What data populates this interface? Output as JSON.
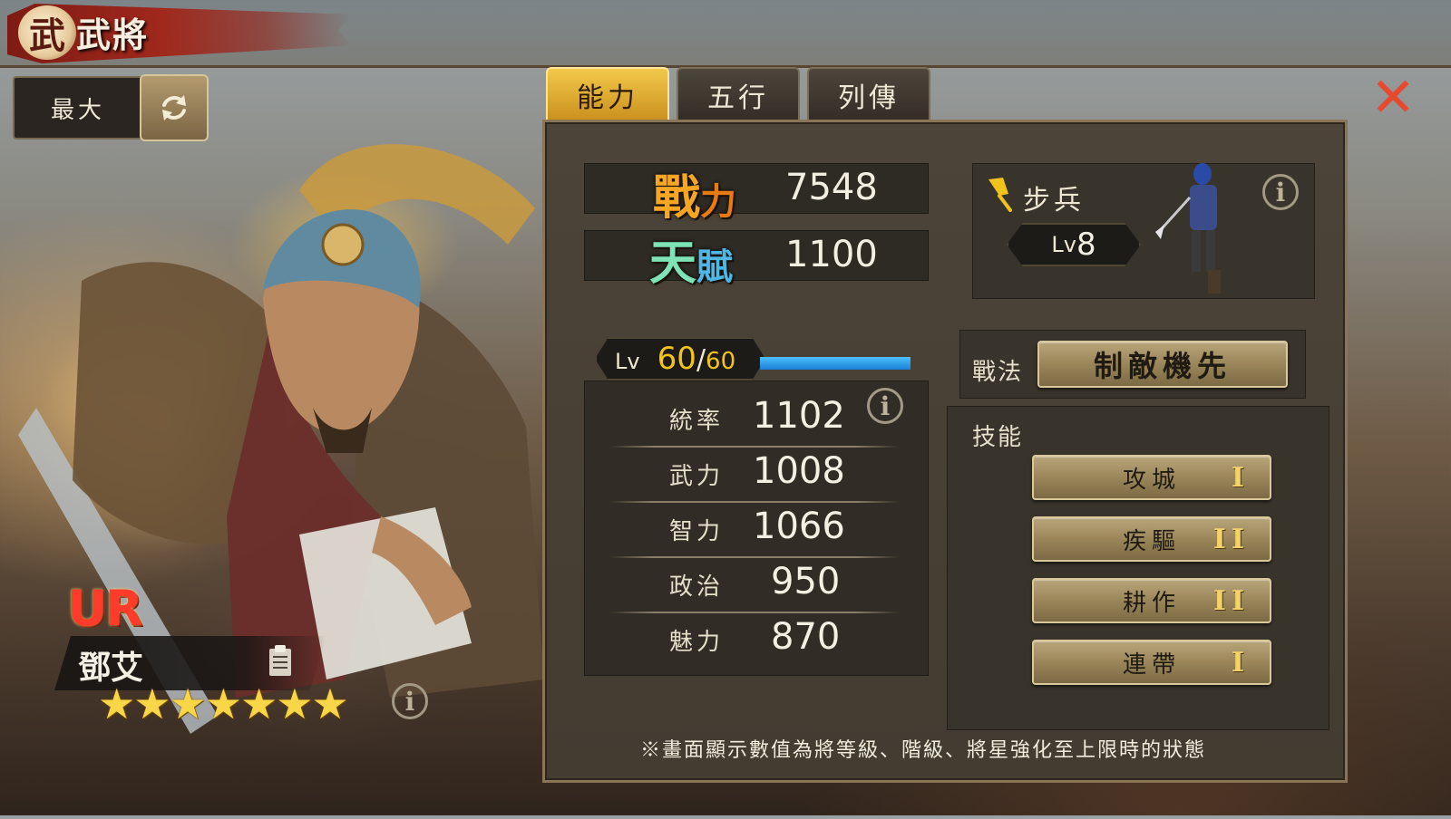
{
  "header": {
    "title": "武將",
    "emblem": "武"
  },
  "controls": {
    "max_label": "最大"
  },
  "tabs": [
    {
      "label": "能力",
      "active": true
    },
    {
      "label": "五行",
      "active": false
    },
    {
      "label": "列傳",
      "active": false
    }
  ],
  "general": {
    "rarity": "UR",
    "name": "鄧艾",
    "stars": "★★★★★★★",
    "star_count": 7
  },
  "power": {
    "label_1": "戰",
    "label_2": "力",
    "value": "7548"
  },
  "talent": {
    "label_1": "天",
    "label_2": "賦",
    "value": "1100"
  },
  "unit": {
    "type": "步兵",
    "level_prefix": "Lv",
    "level": "8"
  },
  "level": {
    "prefix": "Lv",
    "current": "60",
    "sep": "/",
    "max": "60",
    "exp_fraction": 1.0
  },
  "stats": [
    {
      "label": "統率",
      "value": "1102"
    },
    {
      "label": "武力",
      "value": "1008"
    },
    {
      "label": "智力",
      "value": "1066"
    },
    {
      "label": "政治",
      "value": "950"
    },
    {
      "label": "魅力",
      "value": "870"
    }
  ],
  "tactic": {
    "label": "戰法",
    "name": "制敵機先"
  },
  "skills": {
    "label": "技能",
    "items": [
      {
        "name": "攻城",
        "rank": "I"
      },
      {
        "name": "疾驅",
        "rank": "II"
      },
      {
        "name": "耕作",
        "rank": "II"
      },
      {
        "name": "連帶",
        "rank": "I"
      }
    ]
  },
  "footnote": "※畫面顯示數值為將等級、階級、將星強化至上限時的狀態",
  "info_glyph": "i",
  "close_glyph": "✕",
  "colors": {
    "tab_active": "#e2b23a",
    "exp_bar": "#2c9cf0",
    "close": "#e8492e",
    "stars": "#f9d548"
  }
}
